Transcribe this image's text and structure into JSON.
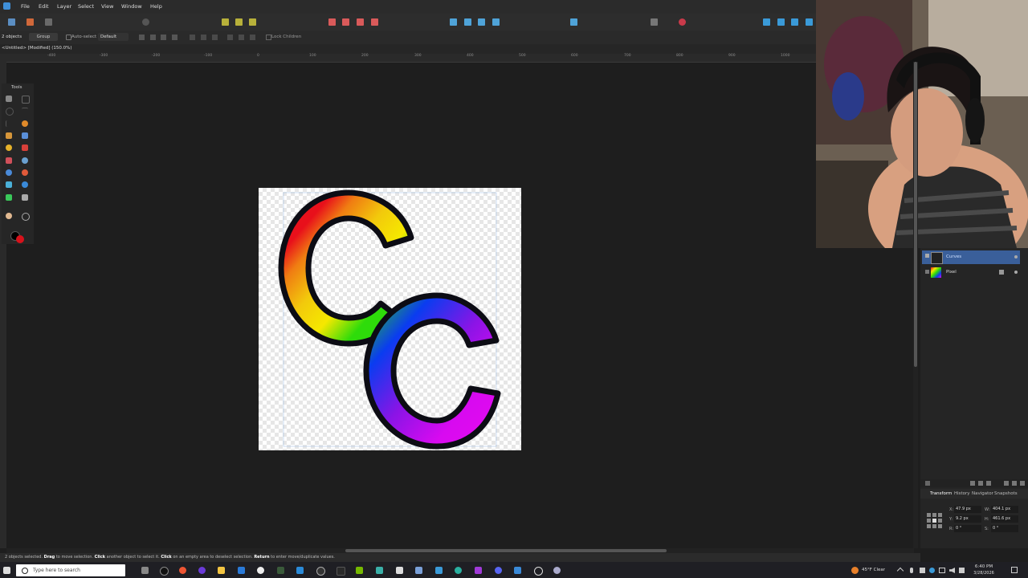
{
  "menu": [
    "File",
    "Edit",
    "Layer",
    "Select",
    "View",
    "Window",
    "Help"
  ],
  "context": {
    "selection_count": "2 objects",
    "group_button": "Group",
    "auto_select_label": "Auto-select",
    "auto_select_value": "Default",
    "lock_children": "Lock Children"
  },
  "document_tab": "<Untitled> [Modified] (150.0%)",
  "ruler_ticks": [
    "-400",
    "-300",
    "-200",
    "-100",
    "0",
    "100",
    "200",
    "300",
    "400",
    "500",
    "600",
    "700",
    "800",
    "900",
    "1000"
  ],
  "tools_title": "Tools",
  "layers": [
    {
      "name": "Curves",
      "selected": true
    },
    {
      "name": "Pixel",
      "selected": false
    }
  ],
  "panel_tabs": [
    "Transform",
    "History",
    "Navigator",
    "Snapshots"
  ],
  "transform": {
    "x_label": "X:",
    "x": "47.9 px",
    "y_label": "Y:",
    "y": "9.2 px",
    "w_label": "W:",
    "w": "404.1 px",
    "h_label": "H:",
    "h": "461.6 px",
    "r_label": "R:",
    "r": "0 °",
    "s_label": "S:",
    "s": "0 °"
  },
  "status": {
    "prefix": "2 objects selected. ",
    "drag": "Drag",
    "t1": " to move selection. ",
    "click1": "Click",
    "t2": " another object to select it. ",
    "click2": "Click",
    "t3": " on an empty area to deselect selection. ",
    "ret": "Return",
    "t4": " to enter move/duplicate values."
  },
  "taskbar": {
    "search_placeholder": "Type here to search",
    "weather": "45°F Clear",
    "time": "6:40 PM",
    "date": "3/28/2026"
  },
  "colors": {
    "accent": "#4a6fa5",
    "rainbow": [
      "#e8101b",
      "#f07d12",
      "#f2c90c",
      "#f5e800",
      "#2edc0a",
      "#0a3cf0",
      "#8a14e6",
      "#d80af0"
    ]
  }
}
